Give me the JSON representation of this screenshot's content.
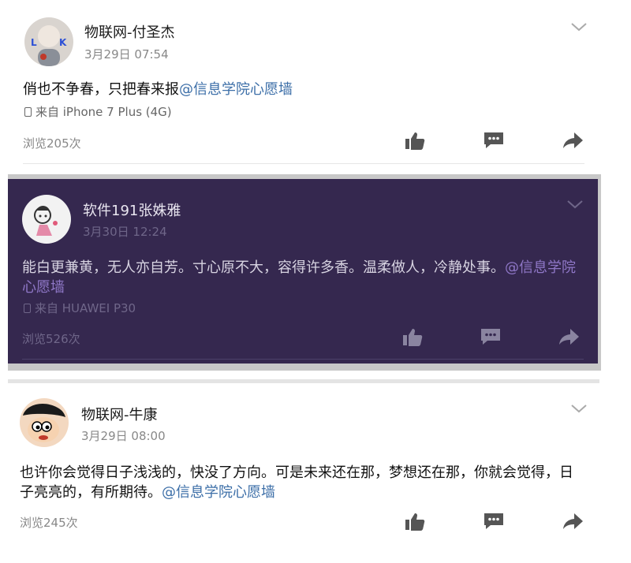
{
  "colors": {
    "mention": "#3d6fa8",
    "dark_panel": "#35284f",
    "icon": "#555555"
  },
  "posts": [
    {
      "author": "物联网-付圣杰",
      "time": "3月29日 07:54",
      "text": "俏也不争春，只把春来报",
      "mention": "@信息学院心愿墙",
      "source": "来自 iPhone 7 Plus (4G)",
      "views": "浏览205次",
      "icons": [
        "like-icon",
        "comment-icon",
        "share-icon",
        "chevron-down-icon"
      ]
    },
    {
      "author": "软件191张姝雅",
      "time": "3月30日 12:24",
      "text": "能白更兼黄，无人亦自芳。寸心原不大，容得许多香。温柔做人，冷静处事。",
      "mention": "@信息学院心愿墙",
      "source": "来自 HUAWEI P30",
      "views": "浏览526次",
      "icons": [
        "like-icon",
        "comment-icon",
        "share-icon",
        "chevron-down-icon"
      ]
    },
    {
      "author": "物联网-牛康",
      "time": "3月29日 08:00",
      "text": "也许你会觉得日子浅浅的，快没了方向。可是未来还在那，梦想还在那，你就会觉得，日子亮亮的，有所期待。",
      "mention": "@信息学院心愿墙",
      "views": "浏览245次",
      "icons": [
        "like-icon",
        "comment-icon",
        "share-icon",
        "chevron-down-icon"
      ]
    }
  ]
}
